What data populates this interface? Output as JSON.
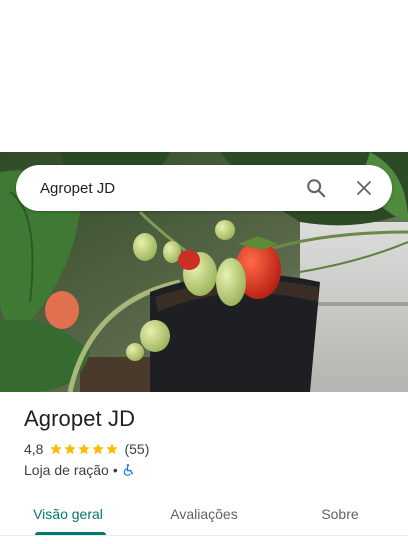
{
  "search": {
    "query": "Agropet JD"
  },
  "place": {
    "name": "Agropet JD",
    "rating": "4,8",
    "stars": 5,
    "reviews": "(55)",
    "category": "Loja de ração",
    "separator": "•",
    "accessibility_icon": "wheelchair-icon"
  },
  "tabs": [
    {
      "label": "Visão geral",
      "active": true
    },
    {
      "label": "Avaliações",
      "active": false
    },
    {
      "label": "Sobre",
      "active": false
    }
  ],
  "colors": {
    "accent": "#00796b",
    "star": "#fbbc04",
    "accessible": "#1a73e8"
  },
  "photo": {
    "subject": "strawberry-plant-photo"
  }
}
